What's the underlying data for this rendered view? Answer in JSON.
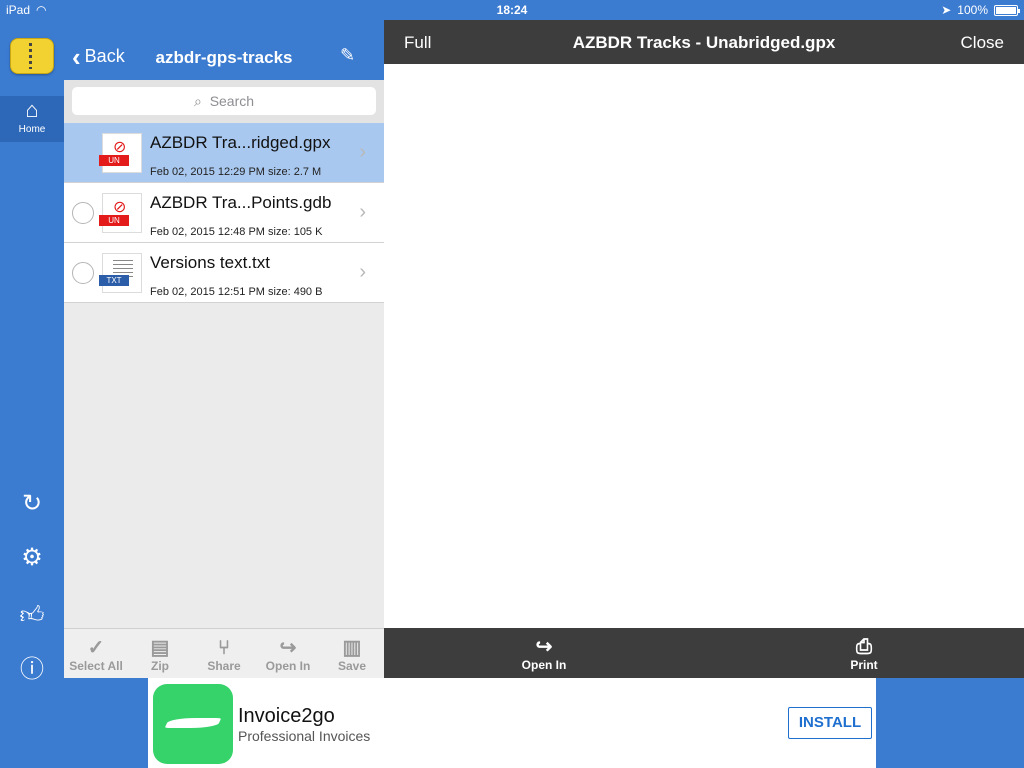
{
  "status_bar": {
    "device": "iPad",
    "time": "18:24",
    "battery": "100%",
    "icons": [
      "wifi-icon",
      "location-icon",
      "battery-icon"
    ]
  },
  "rail": {
    "home_label": "Home",
    "icons": [
      "app-icon",
      "home-icon",
      "redo-icon",
      "gear-icon",
      "thumbs-up-icon",
      "info-icon"
    ]
  },
  "file_panel": {
    "back_label": "Back",
    "title": "azbdr-gps-tracks",
    "search_placeholder": "Search",
    "files": [
      {
        "name": "AZBDR Tra...ridged.gpx",
        "meta": "Feb 02, 2015 12:29 PM  size: 2.7 M",
        "tag": "UN",
        "selected": true
      },
      {
        "name": "AZBDR Tra...Points.gdb",
        "meta": "Feb 02, 2015 12:48 PM  size: 105 K",
        "tag": "UN",
        "selected": false
      },
      {
        "name": "Versions text.txt",
        "meta": "Feb 02, 2015 12:51 PM  size: 490 B",
        "tag": "TXT",
        "selected": false
      }
    ],
    "toolbar": [
      "Select All",
      "Zip",
      "Share",
      "Open In",
      "Save"
    ]
  },
  "viewer": {
    "full_label": "Full",
    "title": "AZBDR Tracks - Unabridged.gpx",
    "close_label": "Close",
    "open_in_label": "Open In",
    "print_label": "Print"
  },
  "ad": {
    "title": "Invoice2go",
    "subtitle": "Professional Invoices",
    "button": "INSTALL"
  },
  "colors": {
    "accent_blue": "#3b7bd0",
    "selected_row": "#a9c8ef",
    "viewer_bar": "#3d3d3d",
    "ad_green": "#36d36b",
    "file_tag_red": "#e31b1b"
  }
}
